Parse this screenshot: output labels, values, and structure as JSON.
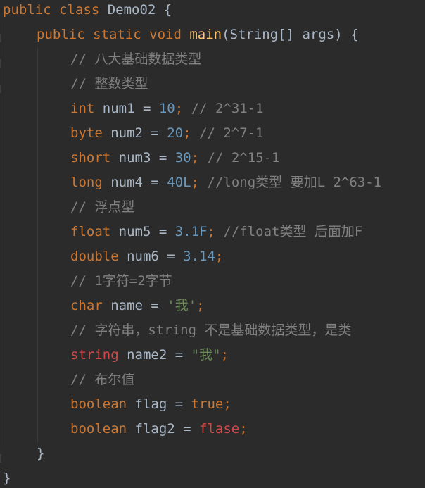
{
  "code": {
    "lines": [
      {
        "indent": 0,
        "tokens": [
          [
            "kw",
            "public class "
          ],
          [
            "plain",
            "Demo02 {"
          ]
        ]
      },
      {
        "indent": 2,
        "tokens": [
          [
            "kw",
            "public static void "
          ],
          [
            "fn",
            "main"
          ],
          [
            "plain",
            "(String[] args) {"
          ]
        ]
      },
      {
        "indent": 4,
        "tokens": [
          [
            "cm",
            "// 八大基础数据类型"
          ]
        ]
      },
      {
        "indent": 4,
        "tokens": [
          [
            "cm",
            "// 整数类型"
          ]
        ]
      },
      {
        "indent": 4,
        "tokens": [
          [
            "kw",
            "int "
          ],
          [
            "plain",
            "num1 = "
          ],
          [
            "num",
            "10"
          ],
          [
            "kw",
            "; "
          ],
          [
            "cm",
            "// 2^31-1"
          ]
        ]
      },
      {
        "indent": 4,
        "tokens": [
          [
            "kw",
            "byte "
          ],
          [
            "plain",
            "num2 = "
          ],
          [
            "num",
            "20"
          ],
          [
            "kw",
            "; "
          ],
          [
            "cm",
            "// 2^7-1"
          ]
        ]
      },
      {
        "indent": 4,
        "tokens": [
          [
            "kw",
            "short "
          ],
          [
            "plain",
            "num3 = "
          ],
          [
            "num",
            "30"
          ],
          [
            "kw",
            "; "
          ],
          [
            "cm",
            "// 2^15-1"
          ]
        ]
      },
      {
        "indent": 4,
        "tokens": [
          [
            "kw",
            "long "
          ],
          [
            "plain",
            "num4 = "
          ],
          [
            "num",
            "40L"
          ],
          [
            "kw",
            "; "
          ],
          [
            "cm",
            "//long类型 要加L 2^63-1"
          ]
        ]
      },
      {
        "indent": 4,
        "tokens": [
          [
            "cm",
            "// 浮点型"
          ]
        ]
      },
      {
        "indent": 4,
        "tokens": [
          [
            "kw",
            "float "
          ],
          [
            "plain",
            "num5 = "
          ],
          [
            "num",
            "3.1F"
          ],
          [
            "kw",
            "; "
          ],
          [
            "cm",
            "//float类型 后面加F"
          ]
        ]
      },
      {
        "indent": 4,
        "tokens": [
          [
            "kw",
            "double "
          ],
          [
            "plain",
            "num6 = "
          ],
          [
            "num",
            "3.14"
          ],
          [
            "kw",
            ";"
          ]
        ]
      },
      {
        "indent": 4,
        "tokens": [
          [
            "cm",
            "// 1字符=2字节"
          ]
        ]
      },
      {
        "indent": 4,
        "tokens": [
          [
            "kw",
            "char "
          ],
          [
            "plain",
            "name = "
          ],
          [
            "str",
            "'我'"
          ],
          [
            "kw",
            ";"
          ]
        ]
      },
      {
        "indent": 4,
        "tokens": [
          [
            "cm",
            "// 字符串，string 不是基础数据类型，是类"
          ]
        ]
      },
      {
        "indent": 4,
        "tokens": [
          [
            "bad",
            "string "
          ],
          [
            "plain",
            "name2 = "
          ],
          [
            "str",
            "\"我\""
          ],
          [
            "kw",
            ";"
          ]
        ]
      },
      {
        "indent": 4,
        "tokens": [
          [
            "cm",
            "// 布尔值"
          ]
        ]
      },
      {
        "indent": 4,
        "tokens": [
          [
            "kw",
            "boolean "
          ],
          [
            "plain",
            "flag = "
          ],
          [
            "kw",
            "true;"
          ]
        ]
      },
      {
        "indent": 4,
        "tokens": [
          [
            "kw",
            "boolean "
          ],
          [
            "plain",
            "flag2 = "
          ],
          [
            "bad",
            "flase"
          ],
          [
            "kw",
            ";"
          ]
        ]
      },
      {
        "indent": 2,
        "tokens": [
          [
            "plain",
            "}"
          ]
        ]
      },
      {
        "indent": 0,
        "tokens": [
          [
            "plain",
            "}"
          ]
        ]
      }
    ]
  }
}
